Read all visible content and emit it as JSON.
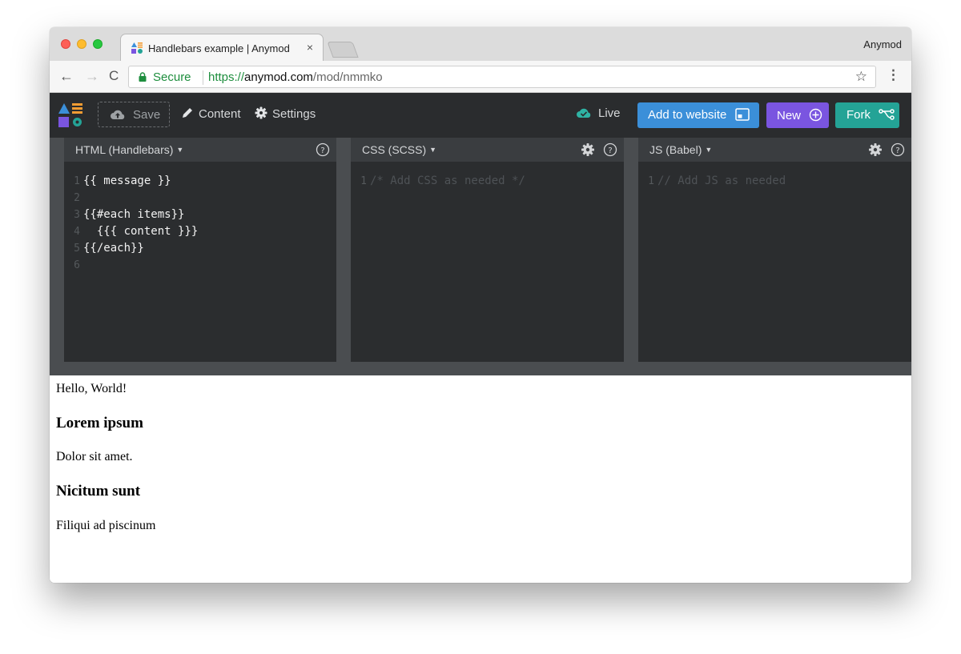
{
  "browser": {
    "tab_title": "Handlebars example | Anymod",
    "tab_close": "×",
    "profile_name": "Anymod",
    "back_icon": "←",
    "forward_icon": "→",
    "reload_icon": "C",
    "secure_label": "Secure",
    "url_scheme": "https://",
    "url_host": "anymod.com",
    "url_path": "/mod/nmmko",
    "bookmark_icon": "☆",
    "menu_icon": "⋮"
  },
  "header": {
    "save_label": "Save",
    "content_label": "Content",
    "settings_label": "Settings",
    "live_label": "Live",
    "add_to_website_label": "Add to website",
    "new_label": "New",
    "fork_label": "Fork",
    "colors": {
      "add": "#3b8fd9",
      "new": "#7a55e0",
      "fork": "#24a396",
      "live": "#2fb3a4"
    }
  },
  "editors": {
    "html": {
      "title": "HTML (Handlebars)",
      "lines": [
        {
          "num": "1",
          "text": "{{ message }}"
        },
        {
          "num": "2",
          "text": ""
        },
        {
          "num": "3",
          "text": "{{#each items}}"
        },
        {
          "num": "4",
          "text": "  {{{ content }}}"
        },
        {
          "num": "5",
          "text": "{{/each}}"
        },
        {
          "num": "6",
          "text": ""
        }
      ]
    },
    "css": {
      "title": "CSS (SCSS)",
      "lines": [
        {
          "num": "1",
          "text": "/* Add CSS as needed */"
        }
      ]
    },
    "js": {
      "title": "JS (Babel)",
      "lines": [
        {
          "num": "1",
          "text": "// Add JS as needed"
        }
      ]
    }
  },
  "preview": {
    "message": "Hello, World!",
    "items": [
      {
        "heading": "Lorem ipsum",
        "body": "Dolor sit amet."
      },
      {
        "heading": "Nicitum sunt",
        "body": "Filiqui ad piscinum"
      }
    ]
  }
}
